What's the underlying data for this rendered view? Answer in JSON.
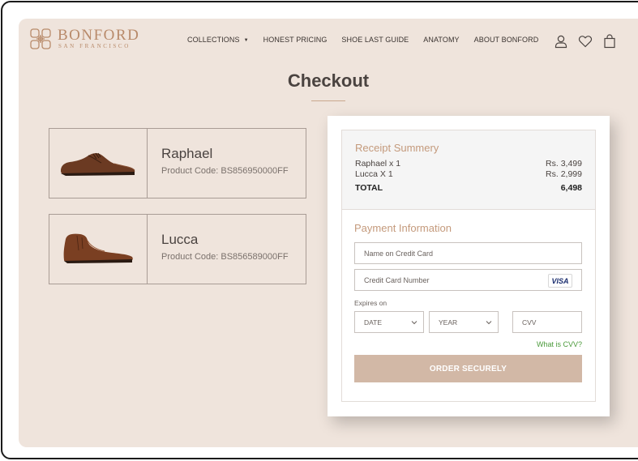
{
  "brand": {
    "name": "BONFORD",
    "subtitle": "SAN FRANCISCO",
    "color": "#b88a6a"
  },
  "nav": {
    "items": [
      {
        "label": "COLLECTIONS"
      },
      {
        "label": "HONEST PRICING"
      },
      {
        "label": "SHOE LAST GUIDE"
      },
      {
        "label": "ANATOMY"
      },
      {
        "label": "ABOUT BONFORD"
      }
    ],
    "icons": [
      "user-icon",
      "heart-icon",
      "shopping-bag-icon"
    ]
  },
  "page": {
    "title": "Checkout"
  },
  "cart": {
    "items": [
      {
        "name": "Raphael",
        "code": "Product Code: BS856950000FF"
      },
      {
        "name": "Lucca",
        "code": "Product Code: BS856589000FF"
      }
    ]
  },
  "receipt": {
    "title": "Receipt Summery",
    "lines": [
      {
        "label": "Raphael x 1",
        "amount": "Rs. 3,499"
      },
      {
        "label": "Lucca X 1",
        "amount": "Rs. 2,999"
      }
    ],
    "total_label": "TOTAL",
    "total_value": "6,498"
  },
  "payment": {
    "title": "Payment Information",
    "name_placeholder": "Name on Credit Card",
    "card_placeholder": "Credit Card Number",
    "card_brand": "VISA",
    "expires_label": "Expires on",
    "date_select": "DATE",
    "year_select": "YEAR",
    "cvv_placeholder": "CVV",
    "cvv_help": "What is CVV?",
    "order_button": "ORDER SECURELY"
  },
  "colors": {
    "background": "#efe4dc",
    "accent": "#c49a7c",
    "button": "#d2b8a6",
    "link": "#4a9a3a"
  }
}
